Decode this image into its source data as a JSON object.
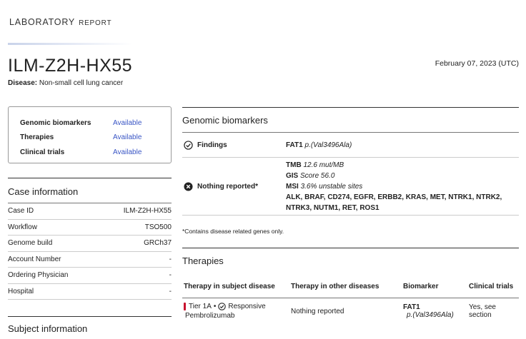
{
  "header": {
    "brand_main": "LABORATORY",
    "brand_sub": "REPORT",
    "sample_id": "ILM-Z2H-HX55",
    "date": "February 07, 2023 (UTC)",
    "disease_label": "Disease:",
    "disease_value": "Non-small cell lung cancer"
  },
  "summary": [
    {
      "label": "Genomic biomarkers",
      "value": "Available"
    },
    {
      "label": "Therapies",
      "value": "Available"
    },
    {
      "label": "Clinical trials",
      "value": "Available"
    }
  ],
  "case_info": {
    "title": "Case information",
    "rows": [
      {
        "label": "Case ID",
        "value": "ILM-Z2H-HX55"
      },
      {
        "label": "Workflow",
        "value": "TSO500"
      },
      {
        "label": "Genome build",
        "value": "GRCh37"
      },
      {
        "label": "Account Number",
        "value": "-"
      },
      {
        "label": "Ordering Physician",
        "value": "-"
      },
      {
        "label": "Hospital",
        "value": "-"
      }
    ]
  },
  "subject_info": {
    "title": "Subject information"
  },
  "genomic_biomarkers": {
    "title": "Genomic biomarkers",
    "findings_label": "Findings",
    "findings_gene": "FAT1",
    "findings_variant": "p.(Val3496Ala)",
    "nothing_label": "Nothing reported*",
    "tmb_label": "TMB",
    "tmb_value": "12.6 mut/MB",
    "gis_label": "GIS",
    "gis_value": "Score 56.0",
    "msi_label": "MSI",
    "msi_value": "3.6% unstable sites",
    "genes_line1": "ALK, BRAF, CD274, EGFR, ERBB2, KRAS, MET, NTRK1, NTRK2,",
    "genes_line2": "NTRK3, NUTM1, RET, ROS1",
    "footnote": "*Contains disease related genes only."
  },
  "therapies": {
    "title": "Therapies",
    "headers": [
      "Therapy in subject disease",
      "Therapy in other diseases",
      "Biomarker",
      "Clinical trials"
    ],
    "row": {
      "tier": "Tier 1A",
      "separator": "•",
      "response": "Responsive",
      "therapy": "Pembrolizumab",
      "other": "Nothing reported",
      "biomarker_gene": "FAT1",
      "biomarker_variant": "p.(Val3496Ala)",
      "trials_line1": "Yes, see",
      "trials_line2": "section"
    }
  },
  "colors": {
    "link": "#3a56c5",
    "tier_1a": "#c8102e"
  }
}
